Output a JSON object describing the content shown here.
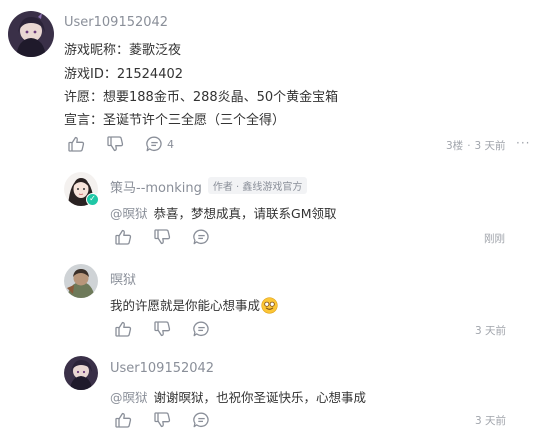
{
  "main_comment": {
    "username": "User109152042",
    "lines": [
      "游戏昵称：菱歌泛夜",
      "游戏ID：21524402",
      "许愿：想要188金币、288炎晶、50个黄金宝箱",
      "宣言：圣诞节许个三全愿（三个全得）"
    ],
    "reply_count": "4",
    "floor": "3楼",
    "time": "3 天前",
    "more": "···"
  },
  "replies": [
    {
      "username": "策马--monking",
      "role": "作者 · 鑫线游戏官方",
      "mention": "@暝狱",
      "text": "恭喜，梦想成真，请联系GM领取",
      "time": "刚刚"
    },
    {
      "username": "暝狱",
      "text": "我的许愿就是你能心想事成",
      "time": "3 天前"
    },
    {
      "username": "User109152042",
      "mention": "@暝狱",
      "text": "谢谢暝狱，也祝你圣诞快乐，心想事成",
      "time": "3 天前"
    }
  ],
  "icons": {
    "like": "thumbs-up-icon",
    "dislike": "thumbs-down-icon",
    "comment": "comment-bubble-icon",
    "verified": "verified-badge-icon",
    "emoji": "smiling-face-emoji"
  },
  "colors": {
    "meta_text": "#a0a4ab",
    "verified_badge": "#1fc7a6"
  }
}
